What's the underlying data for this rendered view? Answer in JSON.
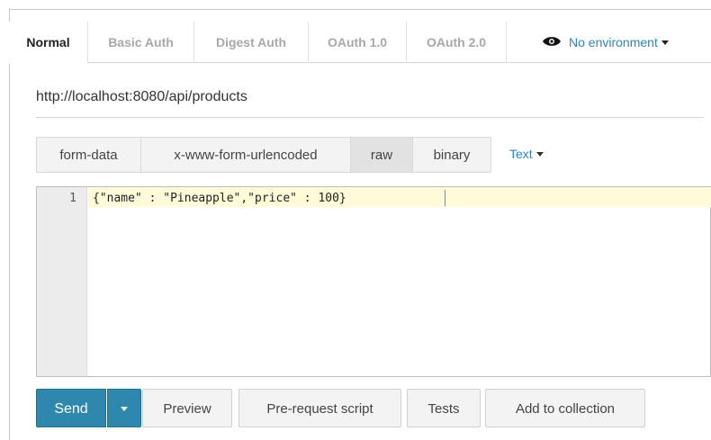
{
  "auth_tabs": [
    {
      "label": "Normal",
      "active": true
    },
    {
      "label": "Basic Auth",
      "active": false
    },
    {
      "label": "Digest Auth",
      "active": false
    },
    {
      "label": "OAuth 1.0",
      "active": false
    },
    {
      "label": "OAuth 2.0",
      "active": false
    }
  ],
  "environment": {
    "label": "No environment",
    "icon": "eye-icon"
  },
  "request": {
    "url": "http://localhost:8080/api/products"
  },
  "body_tabs": [
    {
      "label": "form-data",
      "active": false
    },
    {
      "label": "x-www-form-urlencoded",
      "active": false
    },
    {
      "label": "raw",
      "active": true
    },
    {
      "label": "binary",
      "active": false
    }
  ],
  "format_dropdown": {
    "label": "Text"
  },
  "editor": {
    "line_number": "1",
    "code": "{\"name\" : \"Pineapple\",\"price\" : 100}"
  },
  "actions": {
    "send": "Send",
    "preview": "Preview",
    "pre_request": "Pre-request script",
    "tests": "Tests",
    "add_to_collection": "Add to collection"
  },
  "colors": {
    "accent": "#2a86c8",
    "send_button": "#2e88ad",
    "active_line": "#fffbd8"
  }
}
